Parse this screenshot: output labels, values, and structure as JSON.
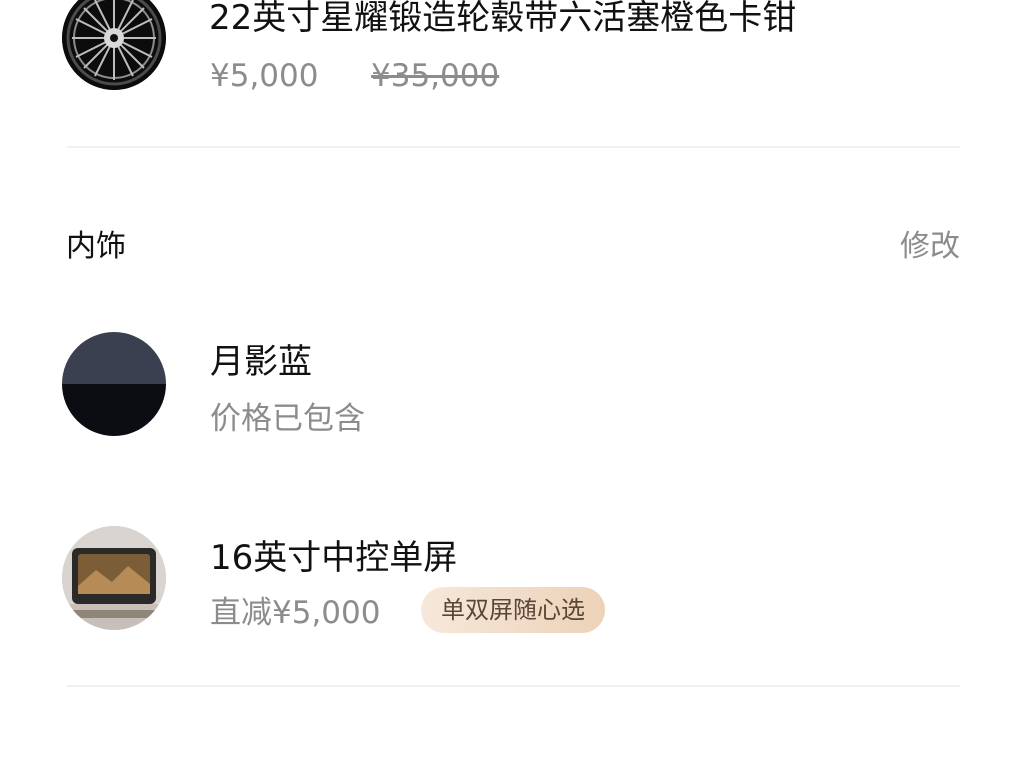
{
  "wheel": {
    "title": "22英寸星耀锻造轮毂带六活塞橙色卡钳",
    "price": "¥5,000",
    "original_price": "¥35,000"
  },
  "interior": {
    "section_title": "内饰",
    "edit_label": "修改",
    "items": [
      {
        "title": "月影蓝",
        "subtitle": "价格已包含"
      },
      {
        "title": "16英寸中控单屏",
        "subtitle": "直减¥5,000",
        "tag": "单双屏随心选"
      }
    ]
  },
  "colors": {
    "text_primary": "#111111",
    "text_secondary": "#8c8c8c",
    "tag_bg_start": "#f6e8da",
    "tag_bg_end": "#ecd2b8",
    "divider": "#f0f0f0"
  },
  "icons": {
    "wheel_thumb": "wheel-rim-image",
    "interior_color_thumb": "color-swatch-image",
    "screen_thumb": "center-screen-image"
  }
}
